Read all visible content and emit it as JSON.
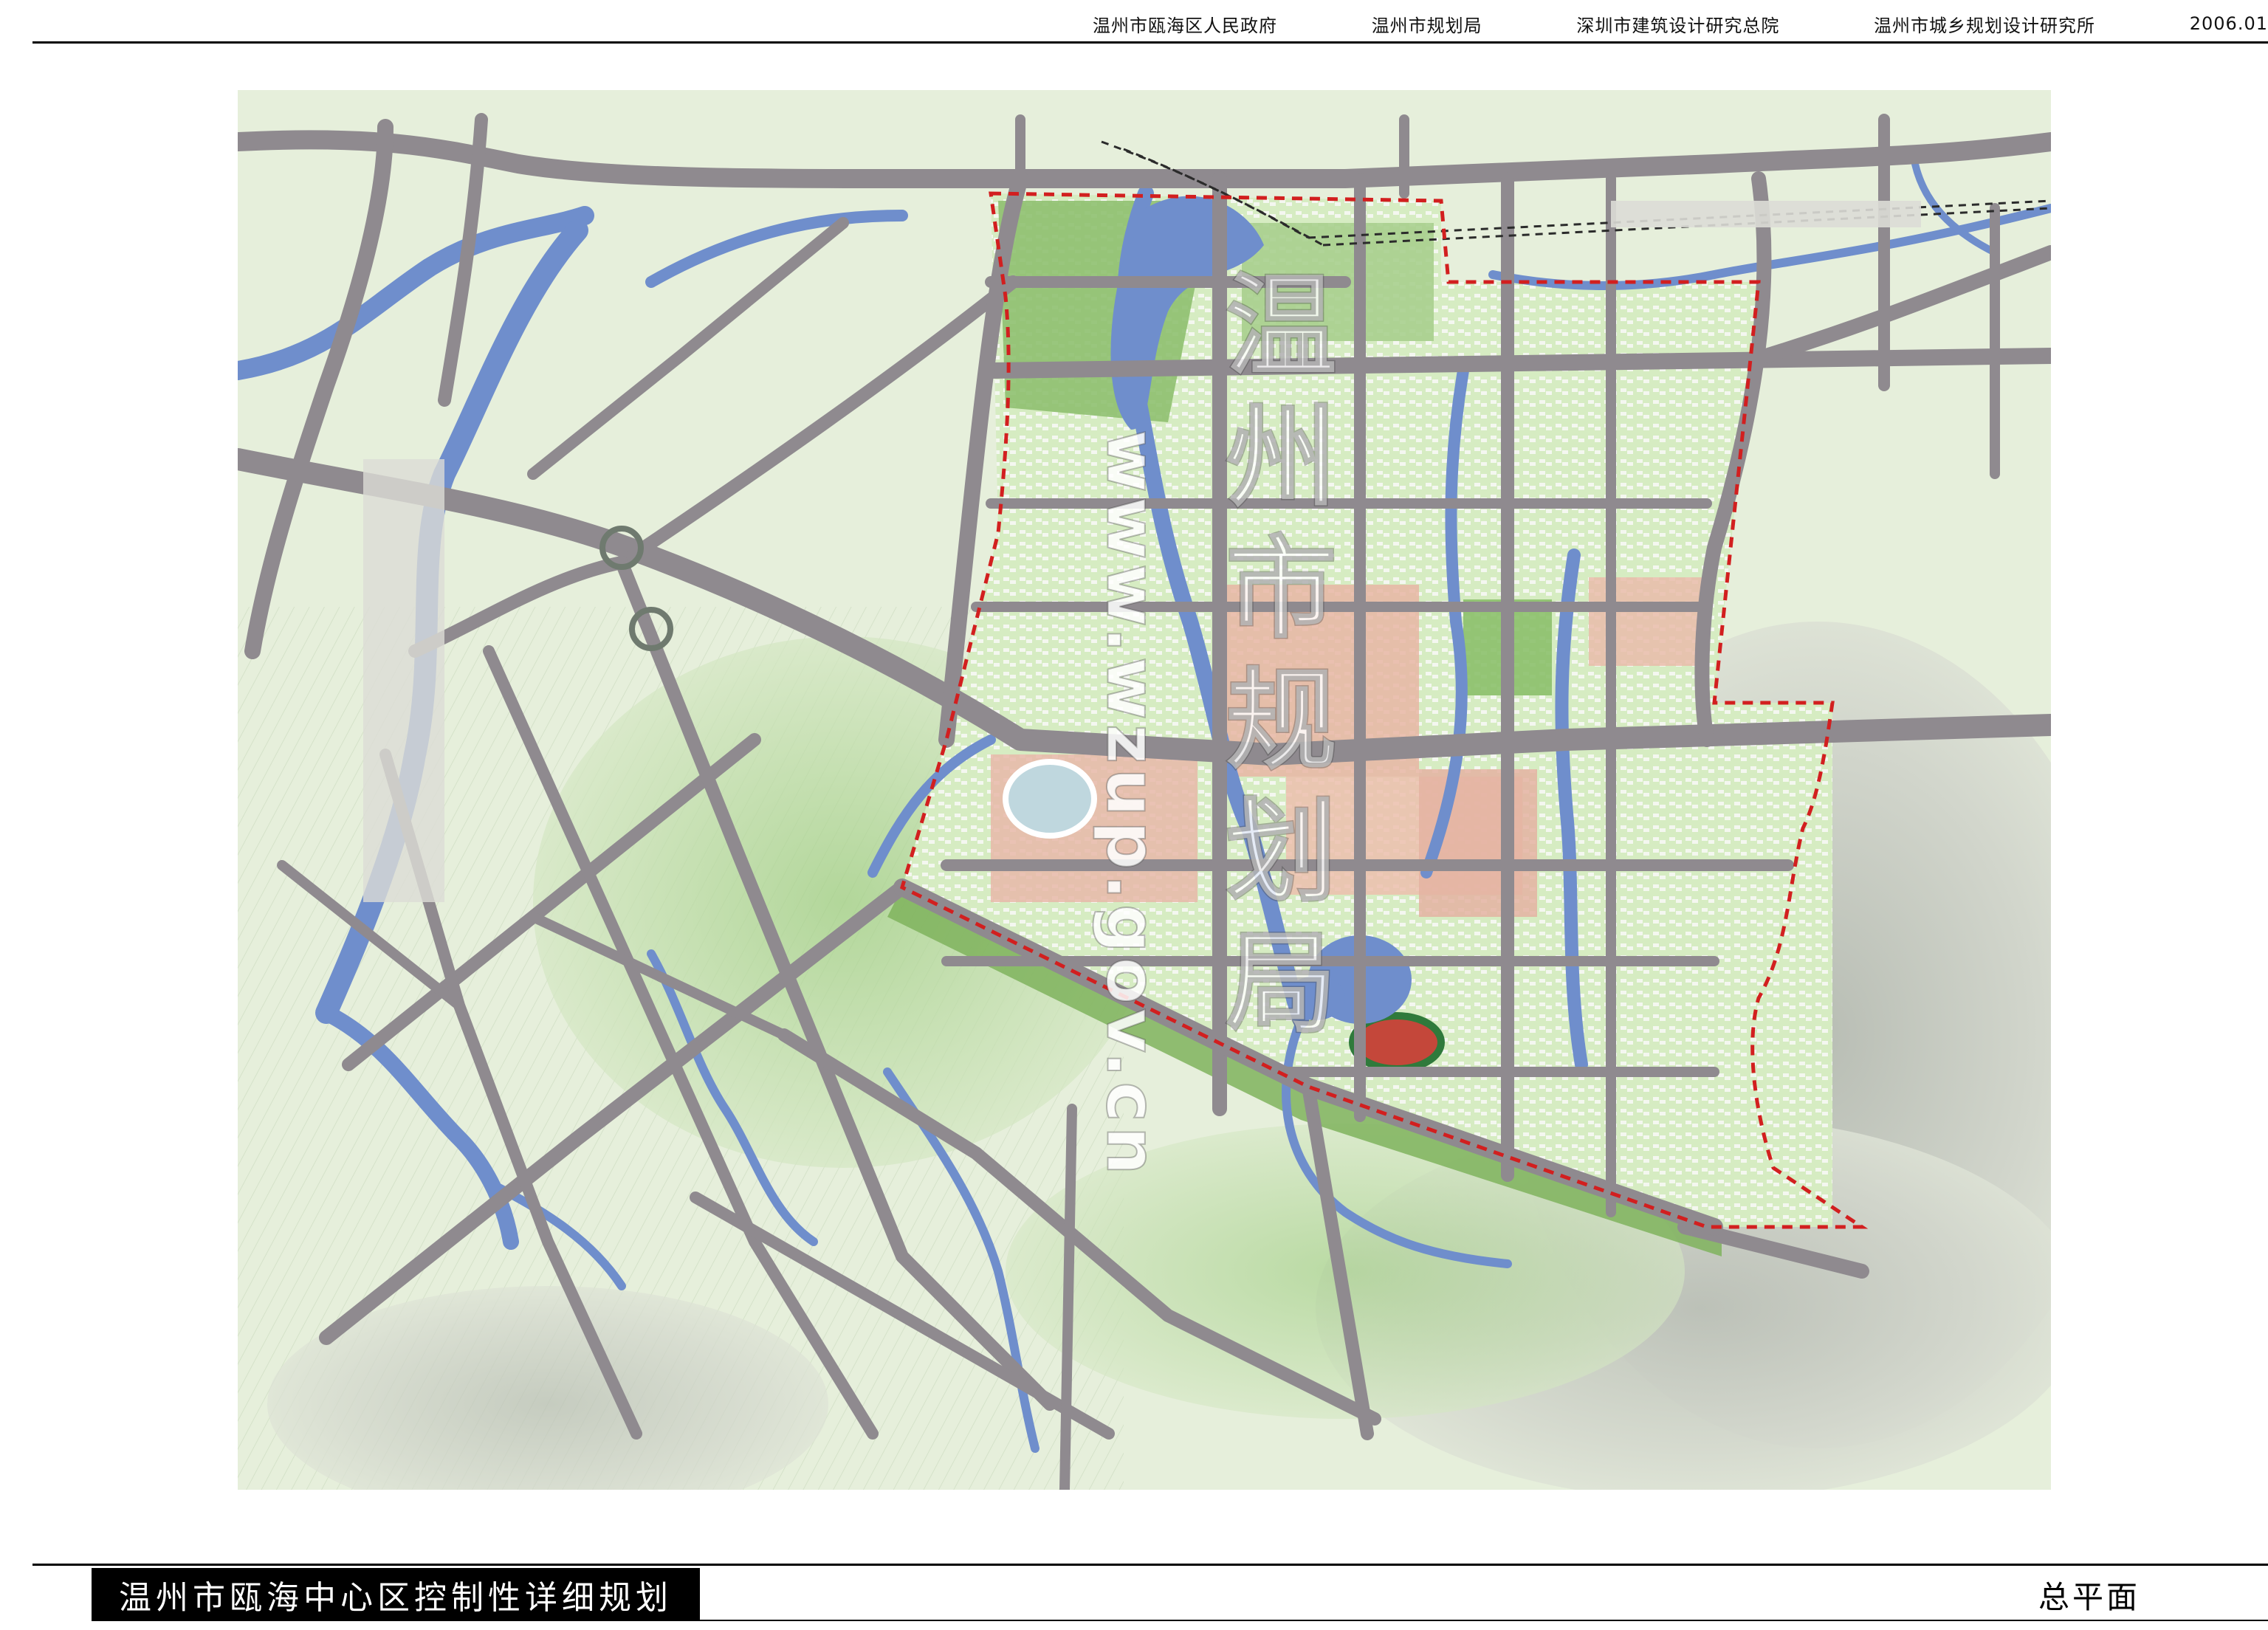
{
  "header": {
    "credits": [
      "温州市瓯海区人民政府",
      "温州市规划局",
      "深圳市建筑设计研究总院",
      "温州市城乡规划设计研究所"
    ],
    "date": "2006.01"
  },
  "footer": {
    "title": "温州市瓯海中心区控制性详细规划",
    "subtitle": "总平面"
  },
  "watermark": {
    "text": "温州市规划局",
    "url": "www.wzup.gov.cn"
  },
  "colors": {
    "road": "#8f8a8f",
    "water": "#6d8fcf",
    "land": "#e5efda",
    "green": "#b9d99b",
    "boundary": "#d21f1f",
    "building": "#e9b7a6"
  }
}
